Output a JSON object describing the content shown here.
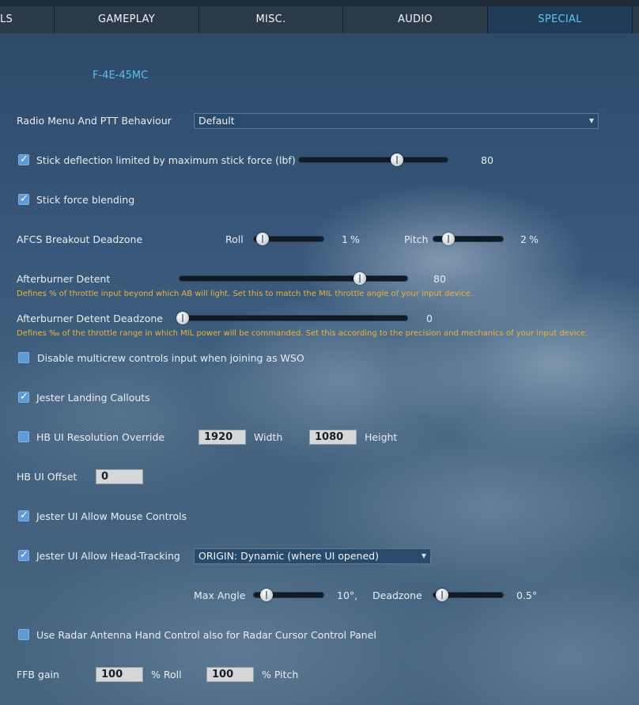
{
  "tabs": [
    "LS",
    "GAMEPLAY",
    "MISC.",
    "AUDIO",
    "SPECIAL"
  ],
  "aircraft": "F-4E-45MC",
  "radio_menu": {
    "label": "Radio Menu And PTT Behaviour",
    "value": "Default"
  },
  "stick_deflection": {
    "label": "Stick deflection limited by maximum stick force (lbf)",
    "checked": true,
    "value": "80",
    "fraction": 0.65
  },
  "stick_force_blending": {
    "label": "Stick force blending",
    "checked": true
  },
  "afcs": {
    "label": "AFCS Breakout Deadzone",
    "roll_label": "Roll",
    "roll_value": "1",
    "roll_unit": "%",
    "roll_fraction": 0.0,
    "pitch_label": "Pitch",
    "pitch_value": "2",
    "pitch_unit": "%",
    "pitch_fraction": 0.0
  },
  "afterburner_detent": {
    "label": "Afterburner Detent",
    "value": "80",
    "fraction": 0.78,
    "hint": "Defines % of throttle input beyond which AB will light. Set this to match the MIL throttle angle of your input device."
  },
  "afterburner_deadzone": {
    "label": "Afterburner Detent Deadzone",
    "value": "0",
    "fraction": 0.0,
    "hint": "Defines ‰ of the throttle range in which MIL power will be commanded. Set this according to the precision and mechanics of your input device."
  },
  "disable_multicrew": {
    "label": "Disable multicrew controls input when joining as WSO",
    "checked": false
  },
  "jester_landing": {
    "label": "Jester Landing Callouts",
    "checked": true
  },
  "hb_ui_resolution": {
    "label": "HB UI Resolution Override",
    "checked": false,
    "width_value": "1920",
    "width_label": "Width",
    "height_value": "1080",
    "height_label": "Height"
  },
  "hb_ui_offset": {
    "label": "HB UI Offset",
    "value": "0"
  },
  "jester_mouse": {
    "label": "Jester UI Allow Mouse Controls",
    "checked": true
  },
  "jester_headtracking": {
    "label": "Jester UI Allow Head-Tracking",
    "checked": true,
    "origin_value": "ORIGIN: Dynamic (where UI opened)"
  },
  "head_tracking_params": {
    "max_angle_label": "Max Angle",
    "max_angle_value": "10°,",
    "max_angle_fraction": 0.05,
    "deadzone_label": "Deadzone",
    "deadzone_value": "0.5°",
    "deadzone_fraction": 0.05
  },
  "radar_antenna": {
    "label": "Use Radar Antenna Hand Control also for Radar Cursor Control Panel",
    "checked": false
  },
  "ffb": {
    "label": "FFB gain",
    "roll_value": "100",
    "roll_label": "% Roll",
    "pitch_value": "100",
    "pitch_label": "% Pitch"
  },
  "colors": {
    "accent": "#5ec8ee",
    "hint": "#e6b53a",
    "checkbox": "#5e9ad6"
  }
}
